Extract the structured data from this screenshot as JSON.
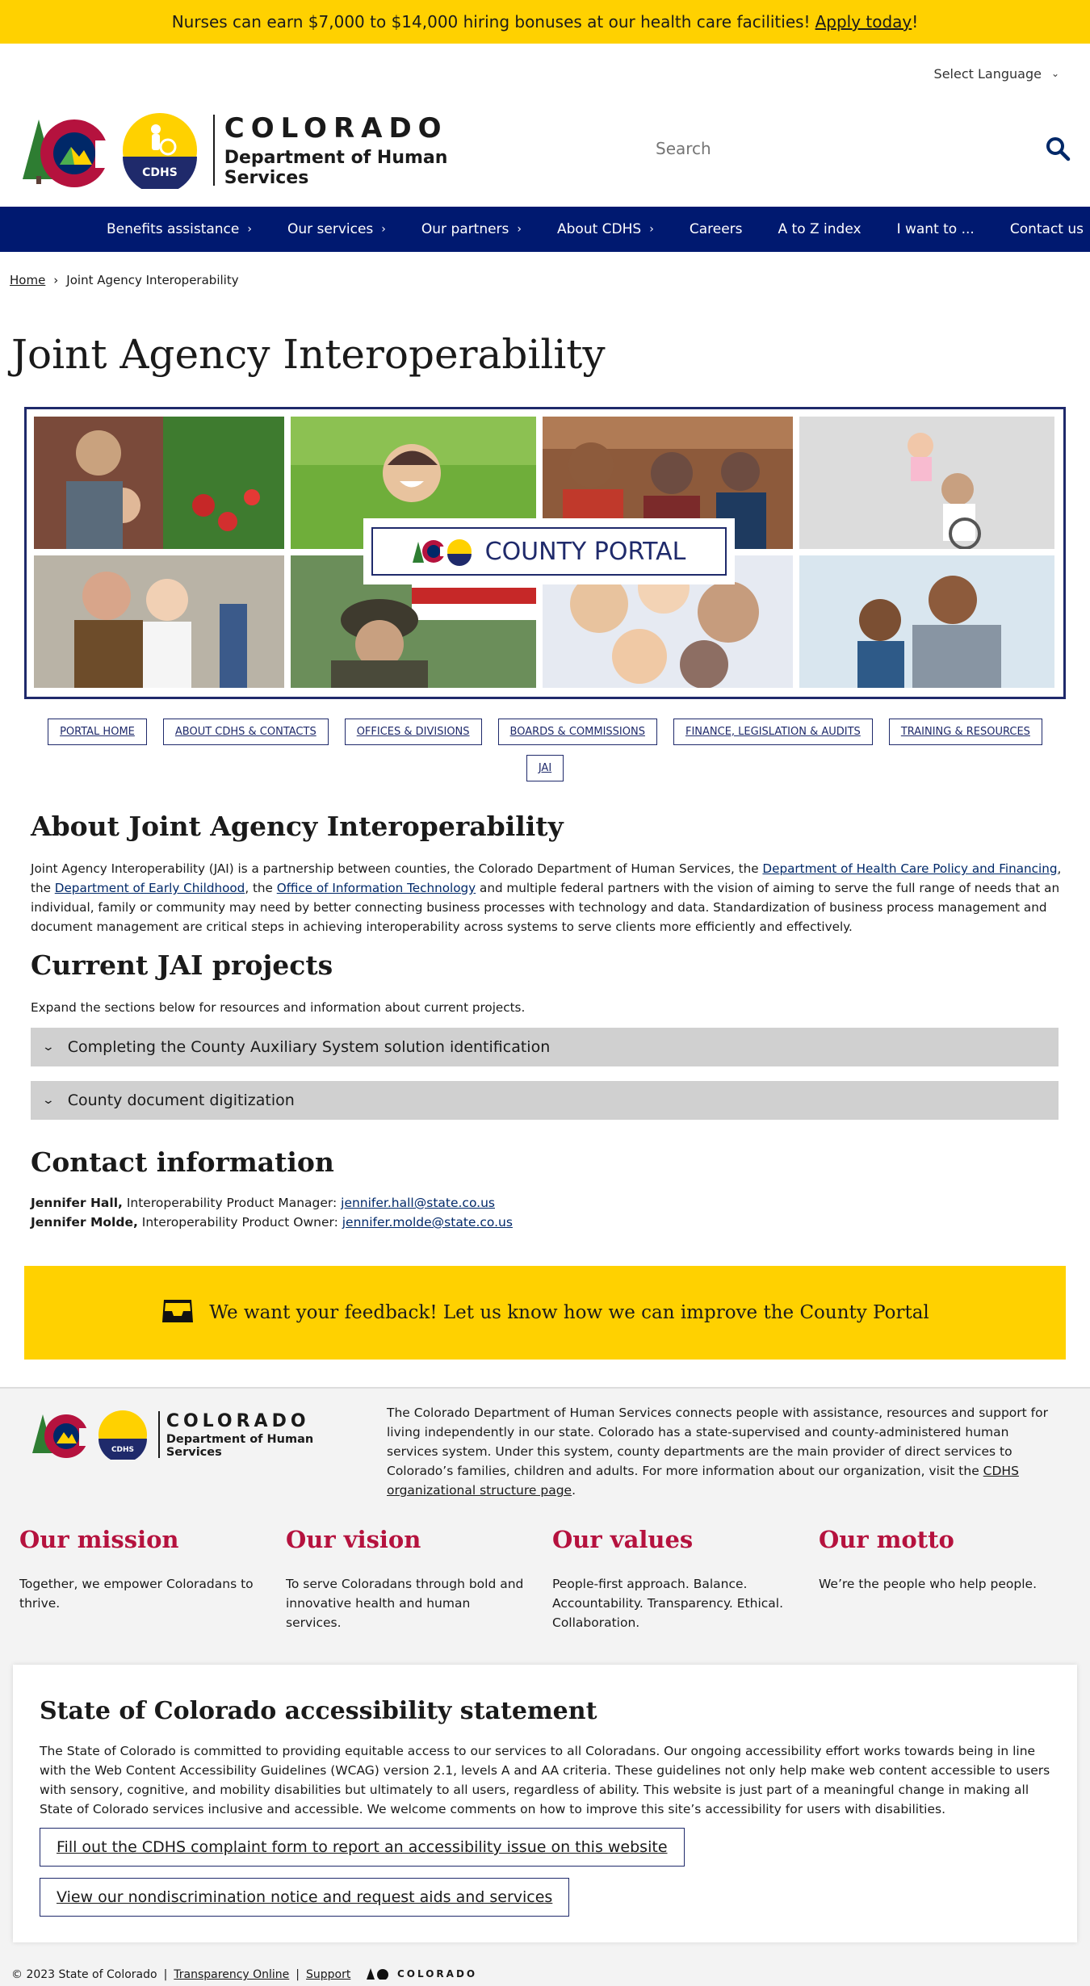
{
  "banner": {
    "text": "Nurses can earn $7,000 to $14,000 hiring bonuses at our health care facilities!",
    "link": "Apply today",
    "suffix": "!"
  },
  "language": {
    "label": "Select Language"
  },
  "header": {
    "brand": "COLORADO",
    "dept": "Department of Human Services",
    "badge": "CDHS",
    "search_placeholder": "Search"
  },
  "nav": {
    "items": [
      {
        "label": "Benefits assistance",
        "has_menu": true
      },
      {
        "label": "Our services",
        "has_menu": true
      },
      {
        "label": "Our partners",
        "has_menu": true
      },
      {
        "label": "About CDHS",
        "has_menu": true
      },
      {
        "label": "Careers",
        "has_menu": false
      },
      {
        "label": "A to Z index",
        "has_menu": false
      },
      {
        "label": "I want to ...",
        "has_menu": false
      },
      {
        "label": "Contact us",
        "has_menu": false
      }
    ]
  },
  "breadcrumb": {
    "home": "Home",
    "sep": "›",
    "current": "Joint Agency Interoperability"
  },
  "page_title": "Joint Agency Interoperability",
  "hero": {
    "portal_label": "COUNTY PORTAL"
  },
  "subnav": {
    "buttons": [
      "PORTAL HOME",
      "ABOUT CDHS & CONTACTS",
      "OFFICES & DIVISIONS",
      "BOARDS & COMMISSIONS",
      "FINANCE, LEGISLATION & AUDITS",
      "TRAINING & RESOURCES",
      "JAI"
    ]
  },
  "about": {
    "heading": "About Joint Agency Interoperability",
    "p1": "Joint Agency Interoperability (JAI) is a partnership between counties, the Colorado Department of Human Services, the ",
    "link1": "Department of Health Care Policy and Financing",
    "p2": ", the ",
    "link2": "Department of Early Childhood",
    "p3": ", the ",
    "link3": "Office of Information Technology",
    "p4": " and multiple federal partners with the vision of aiming to serve the full range of needs that an individual, family or community may need by better connecting business processes with technology and data. Standardization of business process management and document management are critical steps in achieving interoperability across systems to serve clients more efficiently and effectively."
  },
  "projects": {
    "heading": "Current JAI projects",
    "intro": "Expand the sections below for resources and information about current projects.",
    "accordion": [
      "Completing the County Auxiliary System solution identification",
      "County document digitization"
    ]
  },
  "contact": {
    "heading": "Contact information",
    "people": [
      {
        "name": "Jennifer Hall,",
        "role": " Interoperability Product Manager: ",
        "email": "jennifer.hall@state.co.us"
      },
      {
        "name": "Jennifer Molde,",
        "role": " Interoperability Product Owner: ",
        "email": "jennifer.molde@state.co.us"
      }
    ]
  },
  "feedback": {
    "text": "We want your feedback! Let us know how we can improve the County Portal"
  },
  "footer": {
    "brand": "COLORADO",
    "dept": "Department of Human Services",
    "badge": "CDHS",
    "desc": "The Colorado Department of Human Services connects people with assistance, resources and support for living independently in our state. Colorado has a state-supervised and county-administered human services system. Under this system, county departments are the main provider of direct services to Colorado’s families, children and adults. For more information about our organization, visit the ",
    "desc_link": "CDHS organizational structure page",
    "desc_end": ".",
    "pillars": [
      {
        "title": "Our mission",
        "text": "Together, we empower Coloradans to thrive."
      },
      {
        "title": "Our vision",
        "text": "To serve Coloradans through bold and innovative health and human services."
      },
      {
        "title": "Our values",
        "text": "People-first approach. Balance. Accountability. Transparency. Ethical. Collaboration."
      },
      {
        "title": "Our motto",
        "text": "We’re the people who help people."
      }
    ]
  },
  "accessibility": {
    "title": "State of Colorado accessibility statement",
    "text": "The State of Colorado is committed to providing equitable access to our services to all Coloradans. Our ongoing accessibility effort works towards being in line with the Web Content Accessibility Guidelines (WCAG) version 2.1, levels A and AA criteria. These guidelines not only help make web content accessible to users with sensory, cognitive, and mobility disabilities but ultimately to all users, regardless of ability. This website is just part of a meaningful change in making all State of Colorado services inclusive and accessible. We welcome comments on how to improve this site’s accessibility for users with disabilities.",
    "button1": "Fill out the CDHS complaint form to report an accessibility issue on this website",
    "button2": "View our nondiscrimination notice and request aids and services"
  },
  "bottom": {
    "copyright": "© 2023 State of Colorado",
    "sep": "|",
    "link1": "Transparency Online",
    "link2": "Support",
    "logo": "COLORADO"
  },
  "colors": {
    "navy": "#001970",
    "yellow": "#ffd100",
    "crimson": "#b5123e",
    "accordion_gray": "#d0d0d0"
  }
}
